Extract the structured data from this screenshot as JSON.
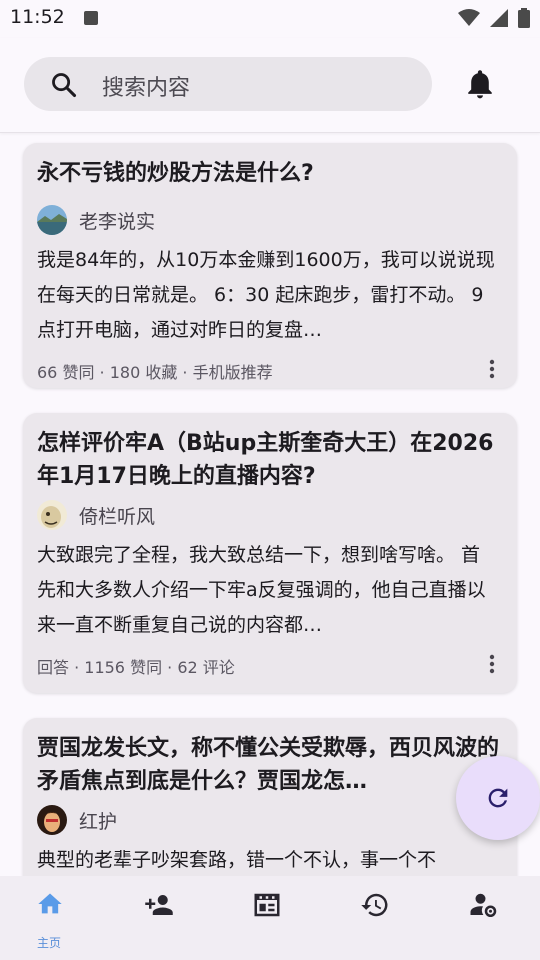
{
  "status_bar": {
    "time": "11:52"
  },
  "search": {
    "placeholder": "搜索内容"
  },
  "cards": [
    {
      "title": "永不亏钱的炒股方法是什么?",
      "author": "老李说实",
      "excerpt": "我是84年的，从10万本金赚到1600万，我可以说说现在每天的日常就是。 6：30 起床跑步，雷打不动。 9点打开电脑，通过对昨日的复盘…",
      "meta": "66 赞同 · 180 收藏 · 手机版推荐"
    },
    {
      "title": "怎样评价牢A（B站up主斯奎奇大王）在2026年1月17日晚上的直播内容?",
      "author": "倚栏听风",
      "excerpt": "大致跟完了全程，我大致总结一下，想到啥写啥。 首先和大多数人介绍一下牢a反复强调的，他自己直播以来一直不断重复自己说的内容都…",
      "meta": "回答 · 1156 赞同 · 62 评论"
    },
    {
      "title": "贾国龙发长文，称不懂公关受欺辱，西贝风波的矛盾焦点到底是什么？贾国龙怎…",
      "author": "红护",
      "excerpt": "典型的老辈子吵架套路，错一个不认，事一个不"
    }
  ],
  "bottom_nav": {
    "items": [
      {
        "icon": "home-icon",
        "label": "主页"
      },
      {
        "icon": "person-add-icon"
      },
      {
        "icon": "feed-icon"
      },
      {
        "icon": "history-icon"
      },
      {
        "icon": "account-settings-icon"
      }
    ]
  },
  "colors": {
    "accent": "#5a8fd8",
    "fab": "#e9ddfb",
    "card": "#ebe7ec"
  }
}
